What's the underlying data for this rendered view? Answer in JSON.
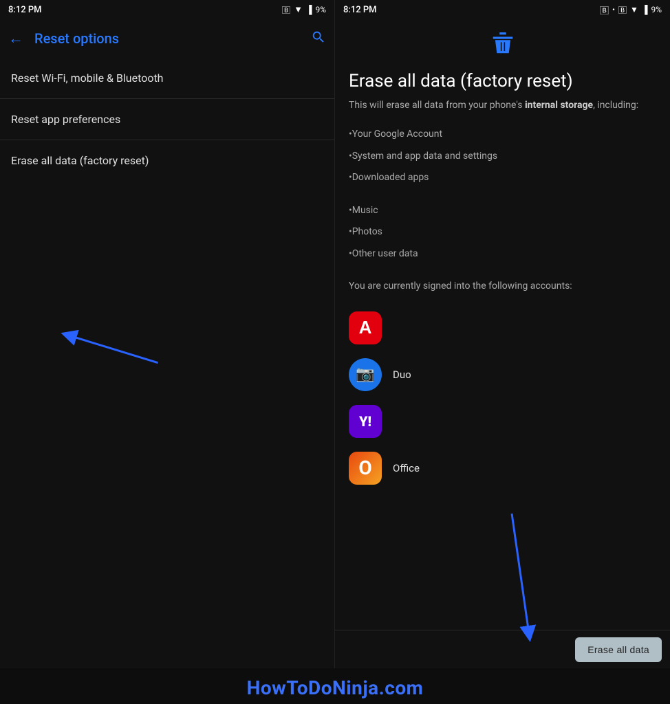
{
  "left_status": {
    "time": "8:12 PM",
    "icons": "🔔 •",
    "right_icons": "bluetooth wifi signal battery",
    "battery": "9%"
  },
  "right_status": {
    "time": "8:12 PM",
    "icons": "🔔 •",
    "battery": "9%"
  },
  "toolbar": {
    "back_label": "←",
    "title": "Reset options",
    "search_label": "🔍"
  },
  "menu": {
    "items": [
      {
        "label": "Reset Wi-Fi, mobile & Bluetooth"
      },
      {
        "label": "Reset app preferences"
      },
      {
        "label": "Erase all data (factory reset)"
      }
    ]
  },
  "erase_panel": {
    "title": "Erase all data (factory reset)",
    "description_prefix": "This will erase all data from your phone's ",
    "description_bold": "internal storage",
    "description_suffix": ", including:",
    "list_items": [
      "•Your Google Account",
      "•System and app data and settings",
      "•Downloaded apps",
      "•Music",
      "•Photos",
      "•Other user data"
    ],
    "accounts_text": "You are currently signed into the following accounts:",
    "apps": [
      {
        "name": "Adobe",
        "icon_type": "adobe",
        "label": ""
      },
      {
        "name": "Duo",
        "icon_type": "duo",
        "label": "Duo"
      },
      {
        "name": "Yahoo",
        "icon_type": "yahoo",
        "label": ""
      },
      {
        "name": "Office",
        "icon_type": "office",
        "label": "Office"
      }
    ],
    "erase_button_label": "Erase all data"
  },
  "watermark": {
    "text": "HowToDoNinja.com"
  }
}
